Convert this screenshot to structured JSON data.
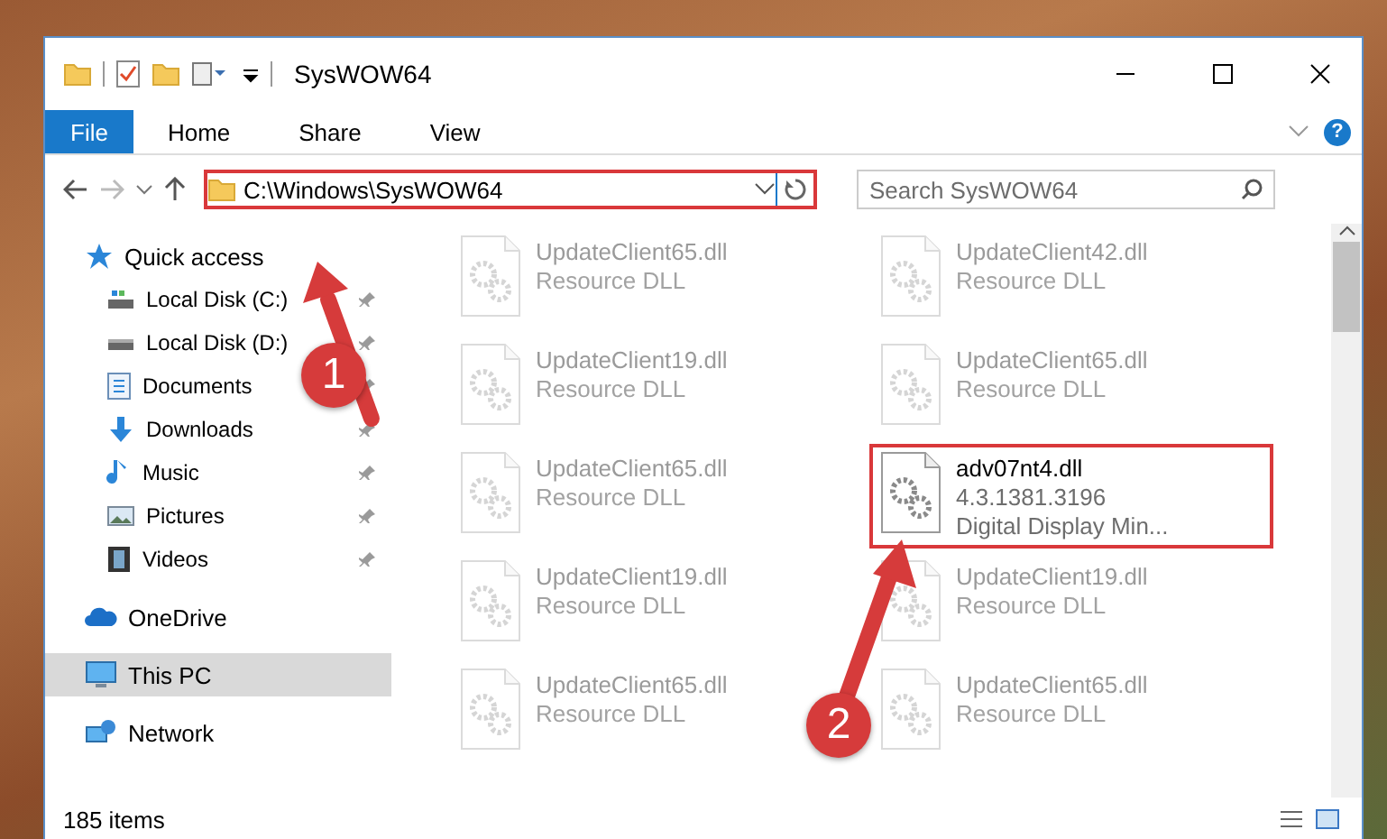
{
  "window": {
    "title": "SysWOW64"
  },
  "ribbon_tabs": [
    {
      "label": "File",
      "selected": true
    },
    {
      "label": "Home",
      "selected": false
    },
    {
      "label": "Share",
      "selected": false
    },
    {
      "label": "View",
      "selected": false
    }
  ],
  "help": {
    "label": "?"
  },
  "address_bar": {
    "value": "C:\\Windows\\SysWOW64",
    "highlighted": true
  },
  "search": {
    "placeholder": "Search SysWOW64"
  },
  "sidebar": {
    "items": [
      {
        "label": "Quick access",
        "selected": false,
        "children": [
          {
            "label": "Local Disk (C:)",
            "pinned": true,
            "selected": false
          },
          {
            "label": "Local Disk (D:)",
            "pinned": true,
            "selected": false
          },
          {
            "label": "Documents",
            "pinned": true,
            "selected": false
          },
          {
            "label": "Downloads",
            "pinned": true,
            "selected": false
          },
          {
            "label": "Music",
            "pinned": true,
            "selected": false
          },
          {
            "label": "Pictures",
            "pinned": true,
            "selected": false
          },
          {
            "label": "Videos",
            "pinned": true,
            "selected": false
          }
        ]
      },
      {
        "label": "OneDrive",
        "selected": false
      },
      {
        "label": "This PC",
        "selected": true
      },
      {
        "label": "Network",
        "selected": false
      }
    ]
  },
  "files": [
    {
      "name": "UpdateClient65.dll",
      "line_2": "Resource DLL",
      "faded": true,
      "highlighted": false
    },
    {
      "name": "UpdateClient42.dll",
      "line_2": "Resource DLL",
      "faded": true,
      "highlighted": false
    },
    {
      "name": "UpdateClient19.dll",
      "line_2": "Resource DLL",
      "faded": true,
      "highlighted": false
    },
    {
      "name": "UpdateClient65.dll",
      "line_2": "Resource DLL",
      "faded": true,
      "highlighted": false
    },
    {
      "name": "UpdateClient65.dll",
      "line_2": "Resource DLL",
      "faded": true,
      "highlighted": false
    },
    {
      "name": "adv07nt4.dll",
      "line_2": "4.3.1381.3196",
      "line_3": "Digital Display Min...",
      "faded": false,
      "highlighted": true
    },
    {
      "name": "UpdateClient19.dll",
      "line_2": "Resource DLL",
      "faded": true,
      "highlighted": false
    },
    {
      "name": "UpdateClient19.dll",
      "line_2": "Resource DLL",
      "faded": true,
      "highlighted": false
    },
    {
      "name": "UpdateClient65.dll",
      "line_2": "Resource DLL",
      "faded": true,
      "highlighted": false
    },
    {
      "name": "UpdateClient65.dll",
      "line_2": "Resource DLL",
      "faded": true,
      "highlighted": false
    }
  ],
  "status_bar": {
    "item_count": "185 items"
  },
  "annotations": [
    {
      "label": "1"
    },
    {
      "label": "2"
    }
  ]
}
